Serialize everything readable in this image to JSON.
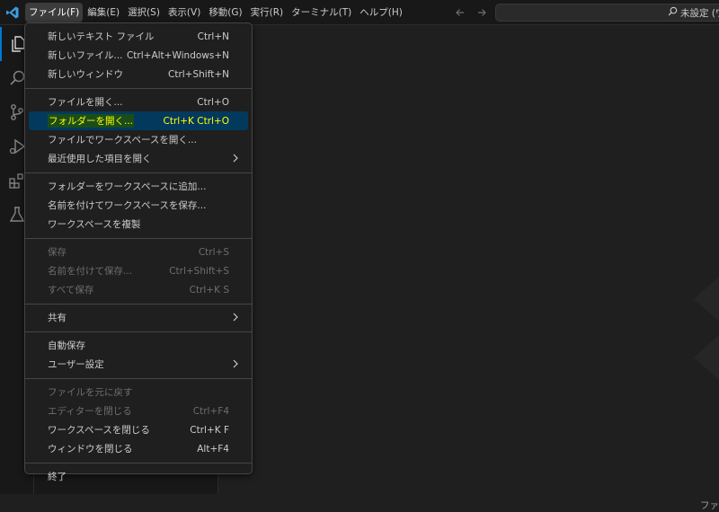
{
  "titlebar": {
    "menus": [
      "ファイル(F)",
      "編集(E)",
      "選択(S)",
      "表示(V)",
      "移動(G)",
      "実行(R)",
      "ターミナル(T)",
      "ヘルプ(H)"
    ],
    "search_text": "未設定 (ワ"
  },
  "editor": {
    "hint_text": "ファ"
  },
  "file_menu": {
    "new_text_file": {
      "label": "新しいテキスト ファイル",
      "shortcut": "Ctrl+N"
    },
    "new_file": {
      "label": "新しいファイル...",
      "shortcut": "Ctrl+Alt+Windows+N"
    },
    "new_window": {
      "label": "新しいウィンドウ",
      "shortcut": "Ctrl+Shift+N"
    },
    "open_file": {
      "label": "ファイルを開く...",
      "shortcut": "Ctrl+O"
    },
    "open_folder": {
      "label": "フォルダーを開く...",
      "shortcut": "Ctrl+K Ctrl+O"
    },
    "open_workspace": {
      "label": "ファイルでワークスペースを開く..."
    },
    "open_recent": {
      "label": "最近使用した項目を開く"
    },
    "add_folder": {
      "label": "フォルダーをワークスペースに追加..."
    },
    "save_workspace_as": {
      "label": "名前を付けてワークスペースを保存..."
    },
    "duplicate_workspace": {
      "label": "ワークスペースを複製"
    },
    "save": {
      "label": "保存",
      "shortcut": "Ctrl+S"
    },
    "save_as": {
      "label": "名前を付けて保存...",
      "shortcut": "Ctrl+Shift+S"
    },
    "save_all": {
      "label": "すべて保存",
      "shortcut": "Ctrl+K S"
    },
    "share": {
      "label": "共有"
    },
    "auto_save": {
      "label": "自動保存"
    },
    "preferences": {
      "label": "ユーザー設定"
    },
    "revert_file": {
      "label": "ファイルを元に戻す"
    },
    "close_editor": {
      "label": "エディターを閉じる",
      "shortcut": "Ctrl+F4"
    },
    "close_workspace": {
      "label": "ワークスペースを閉じる",
      "shortcut": "Ctrl+K F"
    },
    "close_window": {
      "label": "ウィンドウを閉じる",
      "shortcut": "Alt+F4"
    },
    "exit": {
      "label": "終了"
    }
  },
  "colors": {
    "accent": "#0078d4",
    "highlight_bg": "#04395e",
    "highlight_text": "#ffff00"
  }
}
